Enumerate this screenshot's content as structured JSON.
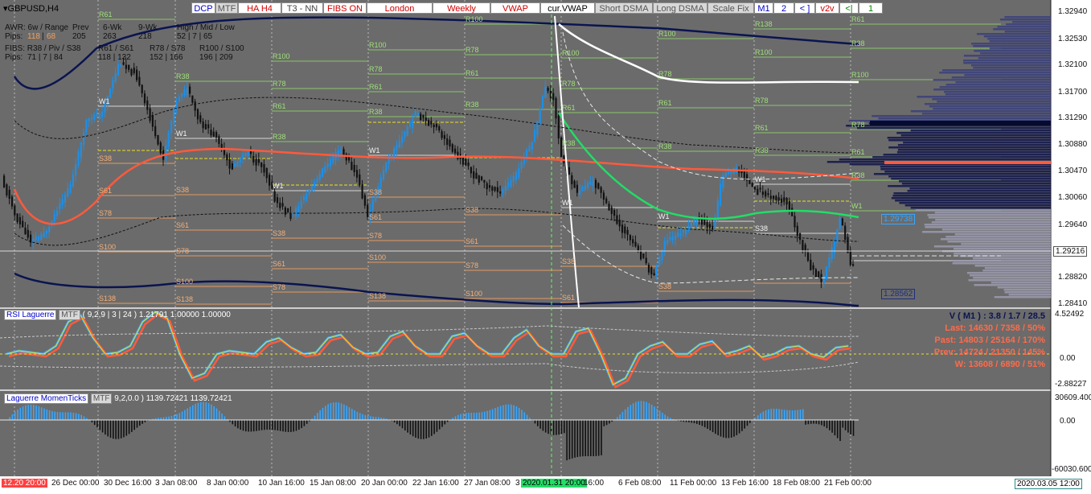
{
  "symbol": "GBPUSD,H4",
  "toolbar": [
    {
      "label": "DCP",
      "color": "#0000c8",
      "bg": "#ffffff"
    },
    {
      "label": "MTF",
      "color": "#555555",
      "bg": "#d8d8d8"
    },
    {
      "label": "HA H4",
      "color": "#d00000",
      "bg": "#ffffff"
    },
    {
      "label": "T3 - NN",
      "color": "#444444",
      "bg": "#ffffff"
    },
    {
      "label": "FIBS ON",
      "color": "#d00000",
      "bg": "#ffffff"
    },
    {
      "label": "London",
      "color": "#d00000",
      "bg": "#ffffff"
    },
    {
      "label": "Weekly",
      "color": "#d00000",
      "bg": "#ffffff"
    },
    {
      "label": "VWAP",
      "color": "#d00000",
      "bg": "#ffffff"
    },
    {
      "label": "cur.VWAP",
      "color": "#000000",
      "bg": "#ffffff"
    },
    {
      "label": "Short DSMA",
      "color": "#555555",
      "bg": "#d8d8d8"
    },
    {
      "label": "Long DSMA",
      "color": "#555555",
      "bg": "#d8d8d8"
    },
    {
      "label": "Scale Fix",
      "color": "#555555",
      "bg": "#d8d8d8"
    },
    {
      "label": "M1",
      "color": "#0000c8",
      "bg": "#ffffff"
    },
    {
      "label": "2",
      "color": "#0000c8",
      "bg": "#ffffff"
    },
    {
      "label": "< ]",
      "color": "#0000c8",
      "bg": "#ffffff"
    },
    {
      "label": "v2v",
      "color": "#d00000",
      "bg": "#ffffff"
    },
    {
      "label": "<|",
      "color": "#008000",
      "bg": "#ffffff"
    },
    {
      "label": "1",
      "color": "#008000",
      "bg": "#ffffff"
    }
  ],
  "stats_table": {
    "row1_label": "AWR: 6w / Range",
    "row1_prev": "Prev",
    "row1_6wk": "6-Wk",
    "row1_9wk": "9-Wk",
    "row1_hml": "High / Mid / Low",
    "row2_label": "Pips:",
    "row2_v1": "118",
    "row2_v2": "68",
    "row2_prev": "205",
    "row2_6wk": "263",
    "row2_9wk": "218",
    "row2_hml": "52  |  7  |  65",
    "row3_label": "FIBS: R38 / Piv / S38",
    "row3_b": "R61 / S61",
    "row3_c": "R78 / S78",
    "row3_d": "R100 / S100",
    "row4_label": "Pips:",
    "row4_a": "71  |  7  |  84",
    "row4_b": "118  |  132",
    "row4_c": "152  |  166",
    "row4_d": "196  |  209"
  },
  "price_axis": [
    "1.32940",
    "1.32530",
    "1.32100",
    "1.31700",
    "1.31290",
    "1.30880",
    "1.30470",
    "1.30060",
    "1.29640",
    "1.29216",
    "1.28820",
    "1.28410"
  ],
  "price_tags": {
    "bid": "1.29216",
    "upper": "1.29738",
    "lower": "1.28562"
  },
  "rsi_axis": [
    "4.52492",
    "0.00",
    "-2.88227"
  ],
  "mom_axis": [
    "30609.400",
    "0.00",
    "-60030.600"
  ],
  "time_axis": [
    "12.20 20:00",
    "26 Dec 00:00",
    "30 Dec 16:00",
    "3 Jan 08:00",
    "8 Jan 00:00",
    "10 Jan 16:00",
    "15 Jan 08:00",
    "20 Jan 00:00",
    "22 Jan 16:00",
    "27 Jan 08:00",
    "3",
    "2020.01.31 20:00",
    "16:00",
    "6 Feb 08:00",
    "11 Feb 00:00",
    "13 Feb 16:00",
    "18 Feb 08:00",
    "21 Feb 00:00",
    "2020.03.05 12:00"
  ],
  "rsi_indicator": {
    "name": "RSI Laguerre",
    "mtf": "MTF",
    "params": "( 9,2,9 | 3 | 24 )",
    "values": "1.21791 1.00000 1.00000"
  },
  "mom_indicator": {
    "name": "Laguerre MomenTicks",
    "mtf": "MTF",
    "params": "9,2,0.0 )",
    "values": "1139.72421 1139.72421"
  },
  "volume_stats": {
    "line1": "V ( M1 ) : 3.8 / 1.7 / 28.5",
    "line2": "Last: 14630 / 7358 / 50%",
    "line3": "Past: 14803 / 25164 / 170%",
    "line4": "Prev: 14724 / 21350 / 145%",
    "line5": "W: 13608 / 6890 / 51%"
  },
  "fib_labels": {
    "block1": [
      "R61",
      "W1",
      "S38",
      "S61",
      "S78",
      "S100",
      "S138"
    ],
    "block2": [
      "R38",
      "W1",
      "S38",
      "S61",
      "S78",
      "S100",
      "S138"
    ],
    "block3": [
      "R100",
      "R78",
      "R61",
      "R38",
      "W1",
      "S38",
      "S61",
      "S78"
    ],
    "block4": [
      "R100",
      "R78",
      "R61",
      "R38",
      "W1",
      "S38",
      "S61",
      "S78",
      "S100",
      "S138"
    ],
    "block5": [
      "R100",
      "R78",
      "R61",
      "R38",
      "S38",
      "S61",
      "S78",
      "S100"
    ],
    "block6": [
      "R100",
      "R78",
      "R61",
      "R38",
      "W1",
      "S38",
      "S61"
    ],
    "block7": [
      "R100",
      "R78",
      "R61",
      "R38",
      "W1",
      "S38"
    ],
    "block8": [
      "R138",
      "R100",
      "R78",
      "R61",
      "R38",
      "W1",
      "S38"
    ],
    "block9": [
      "R61",
      "R38",
      "R100",
      "R78",
      "R61",
      "R38",
      "W1"
    ]
  },
  "colors": {
    "background": "#6b6b6b",
    "bull": "#1e8fe6",
    "bear": "#111111",
    "ema_red": "#ff5a3c",
    "ema_green": "#22dd66",
    "navy": "#0a1450",
    "white_line": "#ffffff",
    "fib_green": "#8fd06a",
    "fib_orange": "#f0a060",
    "yellow": "#e8e020"
  }
}
